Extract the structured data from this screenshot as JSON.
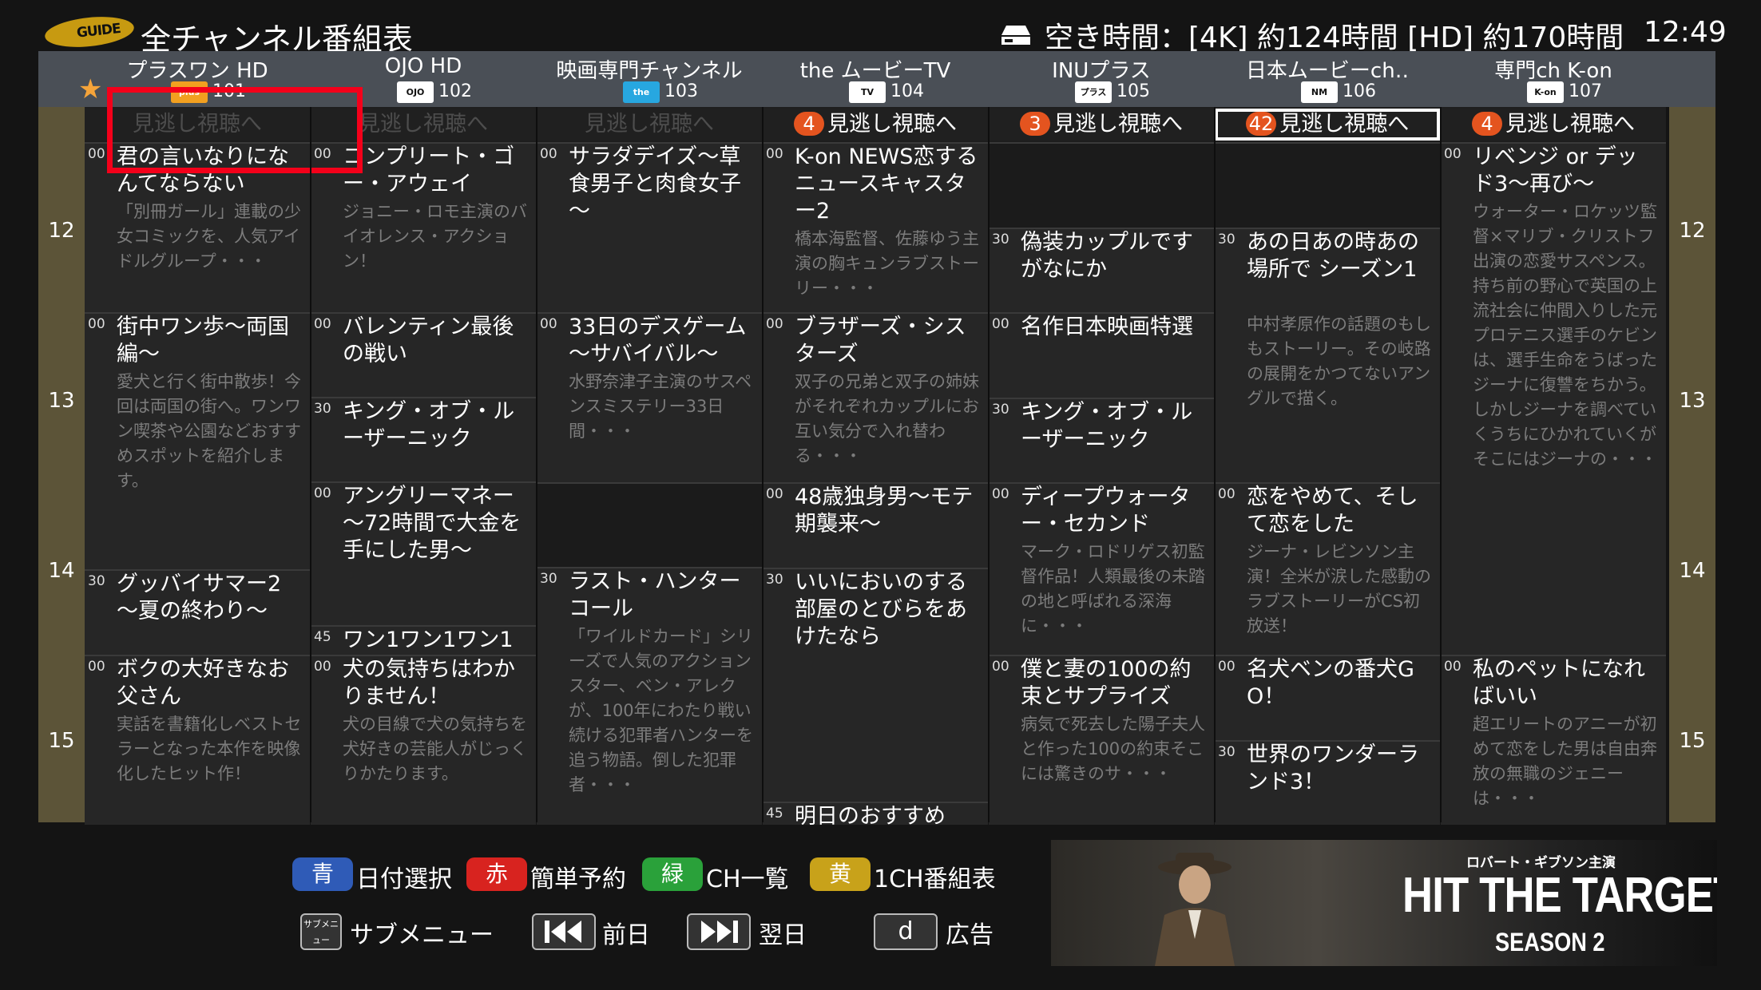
{
  "topbar": {
    "guide_logo": "GUIDE",
    "title": "全チャンネル番組表",
    "rec_icon": "recorder-icon",
    "rec_free": "空き時間：[4K] 約124時間 [HD] 約170時間",
    "clock": "12:49"
  },
  "channels": [
    {
      "name": "プラスワン HD",
      "logo": "plus one",
      "logo_color": "#f2a020",
      "number": "101",
      "favorite": "★",
      "catchup": "見逃し視聴へ",
      "catchup_count": ""
    },
    {
      "name": "OJO HD",
      "logo": "OJO",
      "logo_color": "#ffffff",
      "number": "102",
      "catchup": "見逃し視聴へ",
      "catchup_count": ""
    },
    {
      "name": "映画専門チャンネル",
      "logo": "the MOVIE",
      "logo_color": "#27a7e0",
      "number": "103",
      "catchup": "見逃し視聴へ",
      "catchup_count": ""
    },
    {
      "name": "the ムービーTV",
      "logo": "TV",
      "logo_color": "#ffffff",
      "number": "104",
      "catchup": "見逃し視聴へ",
      "catchup_count": "4"
    },
    {
      "name": "INUプラス",
      "logo": "プラス",
      "logo_color": "#ffffff",
      "number": "105",
      "catchup": "見逃し視聴へ",
      "catchup_count": "3"
    },
    {
      "name": "日本ムービーch‥",
      "logo": "NM",
      "logo_color": "#ffffff",
      "number": "106",
      "catchup": "見逃し視聴へ",
      "catchup_count": "42"
    },
    {
      "name": "専門ch K-on",
      "logo": "K-on",
      "logo_color": "#ffffff",
      "number": "107",
      "catchup": "見逃し視聴へ",
      "catchup_count": "4"
    }
  ],
  "hours": [
    "12",
    "13",
    "14",
    "15"
  ],
  "programs": [
    [
      {
        "min": "00",
        "title": "君の言いなりになんてならない",
        "desc": "「別冊ガール」連載の少女コミックを、人気アイドルグループ・・・"
      },
      {
        "min": "00",
        "title": "街中ワン歩～両国編～",
        "desc": "愛犬と行く街中散歩！今回は両国の街へ。ワンワン喫茶や公園などおすすめスポットを紹介します。"
      },
      {
        "min": "30",
        "title": "グッバイサマー2～夏の終わり～",
        "desc": ""
      },
      {
        "min": "00",
        "title": "ボクの大好きなお父さん",
        "desc": "実話を書籍化しベストセラーとなった本作を映像化したヒット作！"
      }
    ],
    [
      {
        "min": "00",
        "title": "コンプリート・ゴー・アウェイ",
        "desc": "ジョニー・ロモ主演のバイオレンス・アクション！"
      },
      {
        "min": "00",
        "title": "バレンティン最後の戦い",
        "desc": ""
      },
      {
        "min": "30",
        "title": "キング・オブ・ルーザーニック",
        "desc": ""
      },
      {
        "min": "00",
        "title": "アングリーマネー～72時間で大金を手にした男～",
        "desc": ""
      },
      {
        "min": "45",
        "title": "ワン1ワン1ワン1",
        "desc": ""
      },
      {
        "min": "00",
        "title": "犬の気持ちはわかりません！",
        "desc": "犬の目線で犬の気持ちを犬好きの芸能人がじっくりかたります。"
      }
    ],
    [
      {
        "min": "00",
        "title": "サラダデイズ～草食男子と肉食女子～",
        "desc": ""
      },
      {
        "min": "00",
        "title": "33日のデスゲーム～サバイバル～",
        "desc": "水野奈津子主演のサスペンスミステリー33日間・・・"
      },
      {
        "min": "",
        "title": "",
        "desc": ""
      },
      {
        "min": "30",
        "title": "ラスト・ハンターコール",
        "desc": "「ワイルドカード」シリーズで人気のアクションスター、ベン・アレクが、100年にわたり戦い続ける犯罪者ハンターを追う物語。倒した犯罪者・・・"
      }
    ],
    [
      {
        "min": "00",
        "title": "K-on NEWS恋するニュースキャスター2",
        "desc": "橋本海監督、佐藤ゆう主演の胸キュンラブストーリー・・・"
      },
      {
        "min": "00",
        "title": "ブラザーズ・シスターズ",
        "desc": "双子の兄弟と双子の姉妹がそれぞれカップルにお互い気分で入れ替わる・・・"
      },
      {
        "min": "00",
        "title": "48歳独身男～モテ期襲来～",
        "desc": ""
      },
      {
        "min": "30",
        "title": "いいにおいのする部屋のとびらをあけたなら",
        "desc": ""
      },
      {
        "min": "45",
        "title": "明日のおすすめ",
        "desc": ""
      }
    ],
    [
      {
        "min": "",
        "title": "",
        "desc": ""
      },
      {
        "min": "30",
        "title": "偽装カップルですがなにか",
        "desc": ""
      },
      {
        "min": "00",
        "title": "名作日本映画特選",
        "desc": ""
      },
      {
        "min": "30",
        "title": "キング・オブ・ルーザーニック",
        "desc": ""
      },
      {
        "min": "00",
        "title": "ディープウォーター・セカンド",
        "desc": "マーク・ロドリゲス初監督作品！人類最後の未踏の地と呼ばれる深海に・・・"
      },
      {
        "min": "00",
        "title": "僕と妻の100の約束とサプライズ",
        "desc": "病気で死去した陽子夫人と作った100の約束そこには驚きのサ・・・"
      }
    ],
    [
      {
        "min": "",
        "title": "",
        "desc": ""
      },
      {
        "min": "30",
        "title": "あの日あの時あの場所で シーズン1",
        "desc": "中村孝原作の話題のもしもストーリー。その岐路の展開をかつてないアングルで描く。"
      },
      {
        "min": "00",
        "title": "恋をやめて、そして恋をした",
        "desc": "ジーナ・レビンソン主演！全米が涙した感動のラブストーリーがCS初放送！"
      },
      {
        "min": "00",
        "title": "名犬ベンの番犬GO！",
        "desc": ""
      },
      {
        "min": "30",
        "title": "世界のワンダーランド3！",
        "desc": ""
      }
    ],
    [
      {
        "min": "00",
        "title": "リベンジ or デッド3～再び～",
        "desc": "ウォーター・ロケッツ監督×マリブ・クリストフ出演の恋愛サスペンス。持ち前の野心で英国の上流社会に仲間入りした元プロテニス選手のケビンは、選手生命をうばったジーナに復讐をちかう。しかしジーナを調べていくうちにひかれていくがそこにはジーナの・・・"
      },
      {
        "min": "00",
        "title": "私のペットになればいい",
        "desc": "超エリートのアニーが初めて恋をした男は自由奔放の無職のジェニーは・・・"
      }
    ]
  ],
  "keys": [
    {
      "label": "青",
      "text": "日付選択",
      "color": "#2f5bb7"
    },
    {
      "label": "赤",
      "text": "簡単予約",
      "color": "#d8231f"
    },
    {
      "label": "緑",
      "text": "CH一覧",
      "color": "#2aa13a"
    },
    {
      "label": "黄",
      "text": "1CH番組表",
      "color": "#c8a21a"
    }
  ],
  "nav": {
    "submenu_icon": "サブメニュー",
    "submenu": "サブメニュー",
    "prev_icon": "skip-back-icon",
    "prev": "前日",
    "next_icon": "skip-forward-icon",
    "next": "翌日",
    "d_key": "d",
    "ad": "広告"
  },
  "ad": {
    "credit": "ロバート・ギブソン主演",
    "title": "HIT THE TARGET",
    "season": "SEASON 2"
  }
}
